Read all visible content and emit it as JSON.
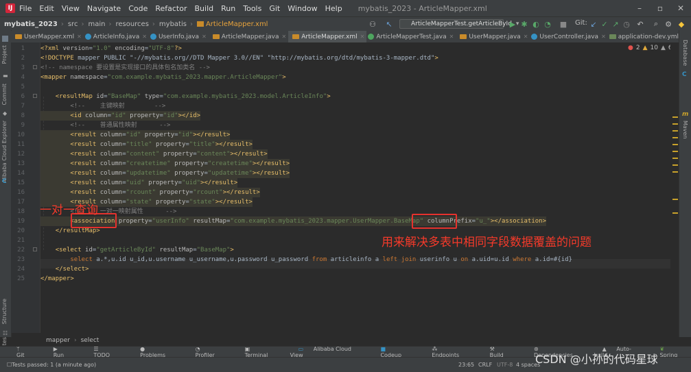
{
  "menubar": {
    "items": [
      "File",
      "Edit",
      "View",
      "Navigate",
      "Code",
      "Refactor",
      "Build",
      "Run",
      "Tools",
      "Git",
      "Window",
      "Help"
    ],
    "window_title": "mybatis_2023 - ArticleMapper.xml"
  },
  "navbar": {
    "crumbs": [
      "mybatis_2023",
      "src",
      "main",
      "resources",
      "mybatis",
      "ArticleMapper.xml"
    ],
    "run_config": "ArticleMapperTest.getArticleById",
    "git_label": "Git:"
  },
  "tabs": [
    {
      "label": "UserMapper.xml",
      "icon": "xml"
    },
    {
      "label": "ArticleInfo.java",
      "icon": "class"
    },
    {
      "label": "UserInfo.java",
      "icon": "class"
    },
    {
      "label": "ArticleMapper.java",
      "icon": "xml"
    },
    {
      "label": "ArticleMapper.xml",
      "icon": "xml",
      "active": true
    },
    {
      "label": "ArticleMapperTest.java",
      "icon": "test"
    },
    {
      "label": "UserMapper.java",
      "icon": "xml"
    },
    {
      "label": "UserController.java",
      "icon": "class"
    },
    {
      "label": "application-dev.yml",
      "icon": "yml"
    },
    {
      "label": "applica",
      "icon": "yml"
    }
  ],
  "inspections": {
    "errors": "2",
    "warnings": "10",
    "weak": "6",
    "typos": "6"
  },
  "left_tools": [
    "Project",
    "Commit",
    "Alibaba Cloud Explorer"
  ],
  "left_tools_bottom": [
    "Structure",
    "Favorites"
  ],
  "right_tools": [
    "Database",
    "Maven"
  ],
  "code_lines": [
    "<?xml version=\"1.0\" encoding=\"UTF-8\"?>",
    "<!DOCTYPE mapper PUBLIC \"-//mybatis.org//DTD Mapper 3.0//EN\" \"http://mybatis.org/dtd/mybatis-3-mapper.dtd\">",
    "<!-- namespace 要设置是实现接口的具体包名加类名 -->",
    "<mapper namespace=\"com.example.mybatis_2023.mapper.ArticleMapper\">",
    "",
    "    <resultMap id=\"BaseMap\" type=\"com.example.mybatis_2023.model.ArticleInfo\">",
    "        <!--    主键映射        -->",
    "        <id column=\"id\" property=\"id\"></id>",
    "        <!--    普通属性映射      -->",
    "        <result column=\"id\" property=\"id\"></result>",
    "        <result column=\"title\" property=\"title\"></result>",
    "        <result column=\"content\" property=\"content\"></result>",
    "        <result column=\"createtime\" property=\"createtime\"></result>",
    "        <result column=\"updatetime\" property=\"updatetime\"></result>",
    "        <result column=\"uid\" property=\"uid\"></result>",
    "        <result column=\"rcount\" property=\"rcount\"></result>",
    "        <result column=\"state\" property=\"state\"></result>",
    "        <!--    一对一映射属性      -->",
    "        <association property=\"userInfo\" resultMap=\"com.example.mybatis_2023.mapper.UserMapper.BaseMap\" columnPrefix=\"u_\"></association>",
    "    </resultMap>",
    "",
    "    <select id=\"getArticleById\" resultMap=\"BaseMap\">",
    "        select a.*,u.id u_id,u.username u_username,u.password u_password from articleinfo a left join userinfo u on a.uid=u.id where a.id=#{id}",
    "    </select>",
    "</mapper>"
  ],
  "annotations": {
    "one_to_one": "一对一查询",
    "column_prefix": "用来解决多表中相同字段数据覆盖的问题"
  },
  "editor_breadcrumb": [
    "mapper",
    "select"
  ],
  "toolwindows": [
    "Git",
    "Run",
    "TODO",
    "Problems",
    "Profiler",
    "Terminal",
    "Alibaba Cloud View",
    "Codeup",
    "Endpoints",
    "Build",
    "Dependencies",
    "Auto-build",
    "Spring"
  ],
  "status": {
    "message": "Tests passed: 1 (a minute ago)",
    "position": "23:65",
    "line_sep": "CRLF",
    "encoding": "UTF-8",
    "indent": "4 spaces"
  },
  "watermark": "CSDN @小孙的代码星球",
  "colors": {
    "annotation_red": "#e5322d",
    "tag": "#e8bf6a",
    "string": "#6a8759",
    "comment": "#808080",
    "keyword": "#cc7832"
  }
}
